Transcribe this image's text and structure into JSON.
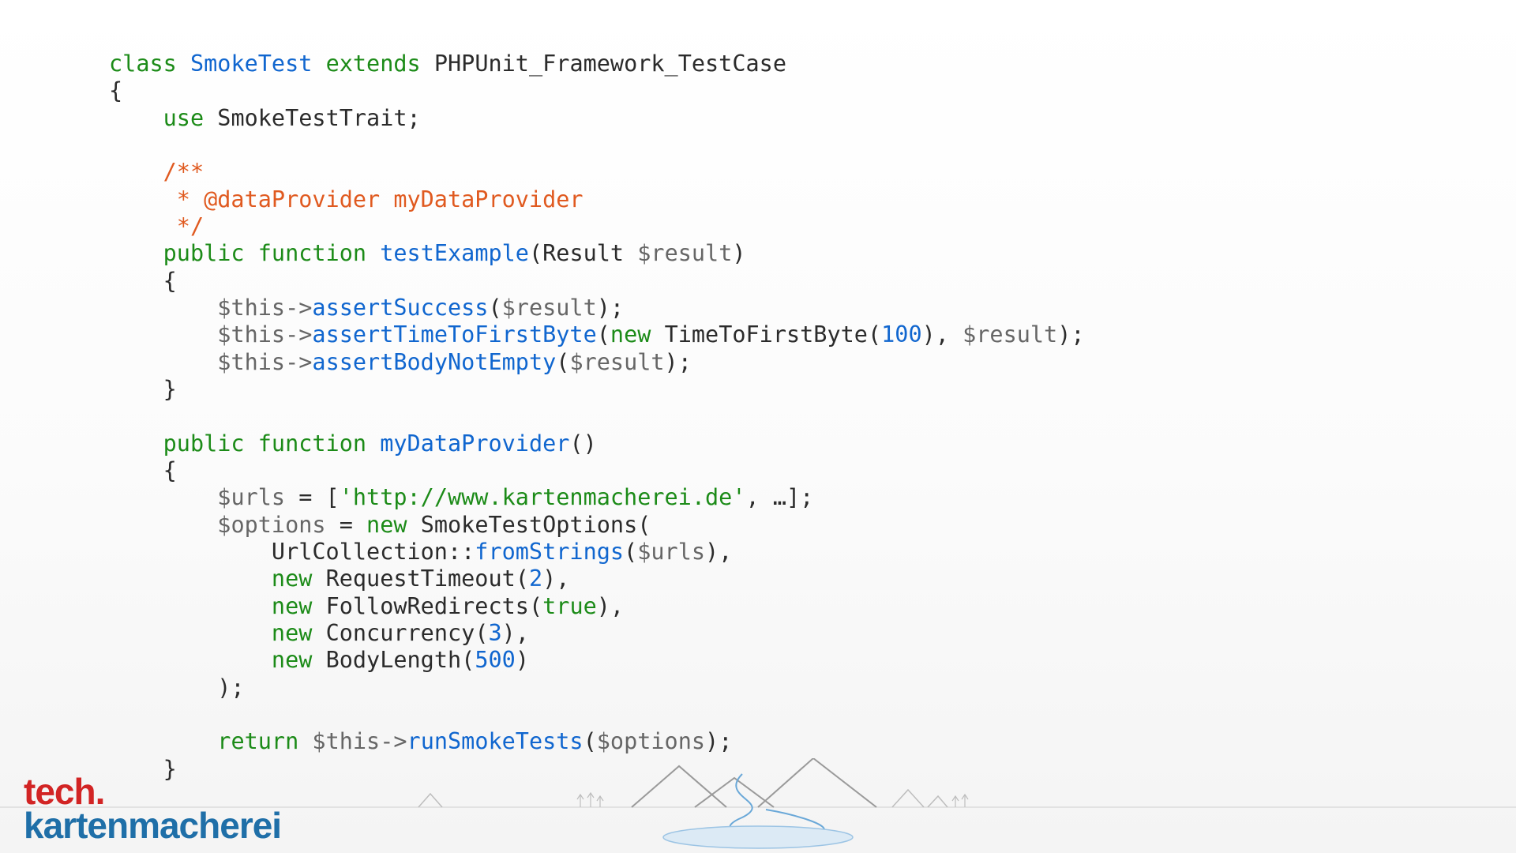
{
  "logo": {
    "line1": "tech.",
    "line2": "kartenmacherei"
  },
  "code": {
    "classKw": "class",
    "className": "SmokeTest",
    "extendsKw": "extends",
    "baseClass": "PHPUnit_Framework_TestCase",
    "openBrace": "{",
    "useKw": "use",
    "traitName": "SmokeTestTrait",
    "doc1": "/**",
    "doc2": " * @dataProvider myDataProvider",
    "doc3": " */",
    "publicKw": "public",
    "functionKw": "function",
    "m1Name": "testExample",
    "m1ParamType": "Result",
    "m1ParamVar": "$result",
    "thisVar": "$this",
    "assertSuccess": "assertSuccess",
    "assertTTFB": "assertTimeToFirstByte",
    "ttfbClass": "TimeToFirstByte",
    "ttfbVal": "100",
    "assertBody": "assertBodyNotEmpty",
    "m2Name": "myDataProvider",
    "urlsVar": "$urls",
    "urlLit": "'http://www.kartenmacherei.de'",
    "ellipsis": "…",
    "optionsVar": "$options",
    "newKw": "new",
    "smokeOpts": "SmokeTestOptions",
    "urlColl": "UrlCollection",
    "fromStrings": "fromStrings",
    "reqTimeout": "RequestTimeout",
    "reqTimeoutVal": "2",
    "followRedir": "FollowRedirects",
    "trueLit": "true",
    "concurrency": "Concurrency",
    "concurrencyVal": "3",
    "bodyLength": "BodyLength",
    "bodyLengthVal": "500",
    "returnKw": "return",
    "runSmoke": "runSmokeTests",
    "closeBrace": "}"
  }
}
